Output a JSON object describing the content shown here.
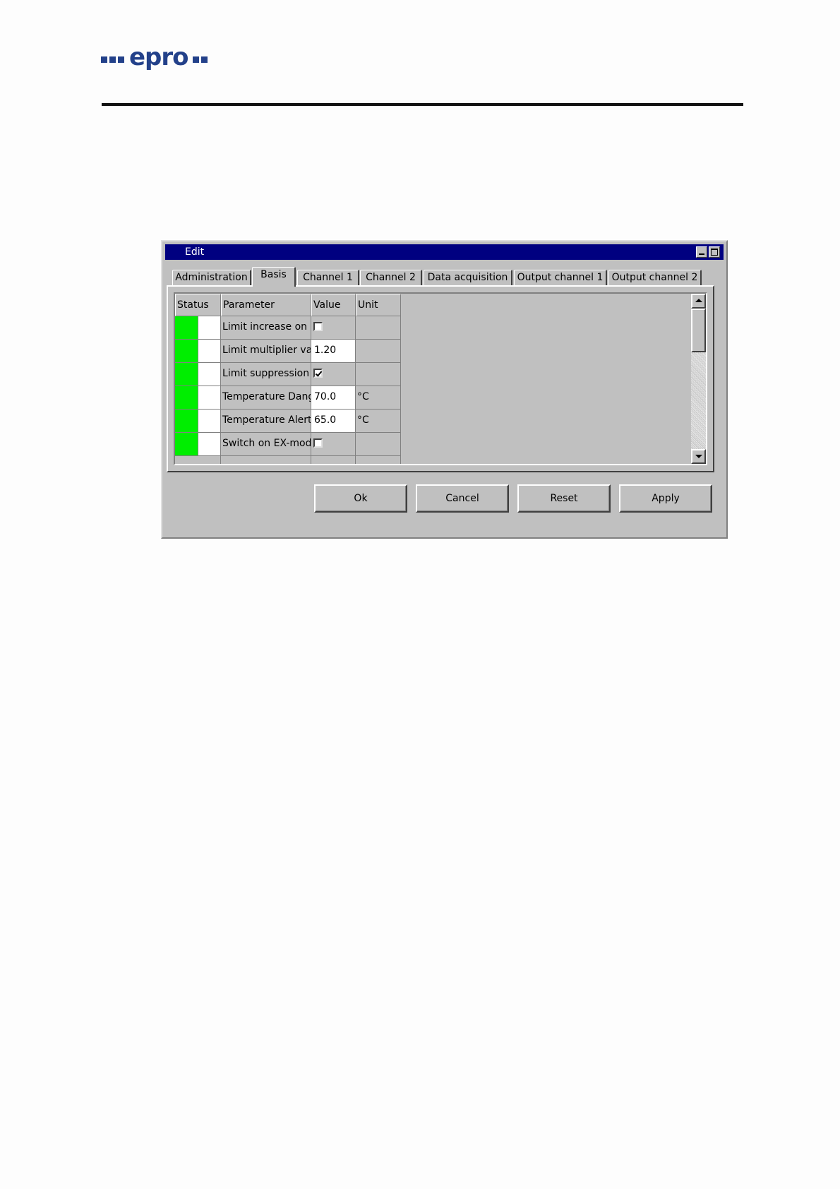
{
  "header": {
    "logo_text": "epro"
  },
  "dialog": {
    "title": "Edit",
    "tabs": [
      {
        "label": "Administration"
      },
      {
        "label": "Basis",
        "active": true
      },
      {
        "label": "Channel 1"
      },
      {
        "label": "Channel 2"
      },
      {
        "label": "Data acquisition"
      },
      {
        "label": "Output channel 1"
      },
      {
        "label": "Output channel 2"
      }
    ],
    "grid": {
      "columns": [
        "Status",
        "Parameter",
        "Value",
        "Unit"
      ],
      "rows": [
        {
          "status_color": "#00ee00",
          "parameter": "Limit increase on",
          "value_type": "checkbox",
          "checked": false,
          "value": "",
          "unit": ""
        },
        {
          "status_color": "#00ee00",
          "parameter": "Limit multiplier value",
          "value_type": "text",
          "value": "1.20",
          "unit": ""
        },
        {
          "status_color": "#00ee00",
          "parameter": "Limit suppression on",
          "value_type": "checkbox",
          "checked": true,
          "value": "",
          "unit": ""
        },
        {
          "status_color": "#00ee00",
          "parameter": "Temperature Dange",
          "value_type": "text",
          "value": "70.0",
          "unit": "°C"
        },
        {
          "status_color": "#00ee00",
          "parameter": "Temperature Alert",
          "value_type": "text",
          "value": "65.0",
          "unit": "°C"
        },
        {
          "status_color": "#00ee00",
          "parameter": "Switch on EX-mode",
          "value_type": "checkbox",
          "checked": false,
          "value": "",
          "unit": ""
        }
      ]
    },
    "buttons": {
      "ok": "Ok",
      "cancel": "Cancel",
      "reset": "Reset",
      "apply": "Apply"
    }
  }
}
